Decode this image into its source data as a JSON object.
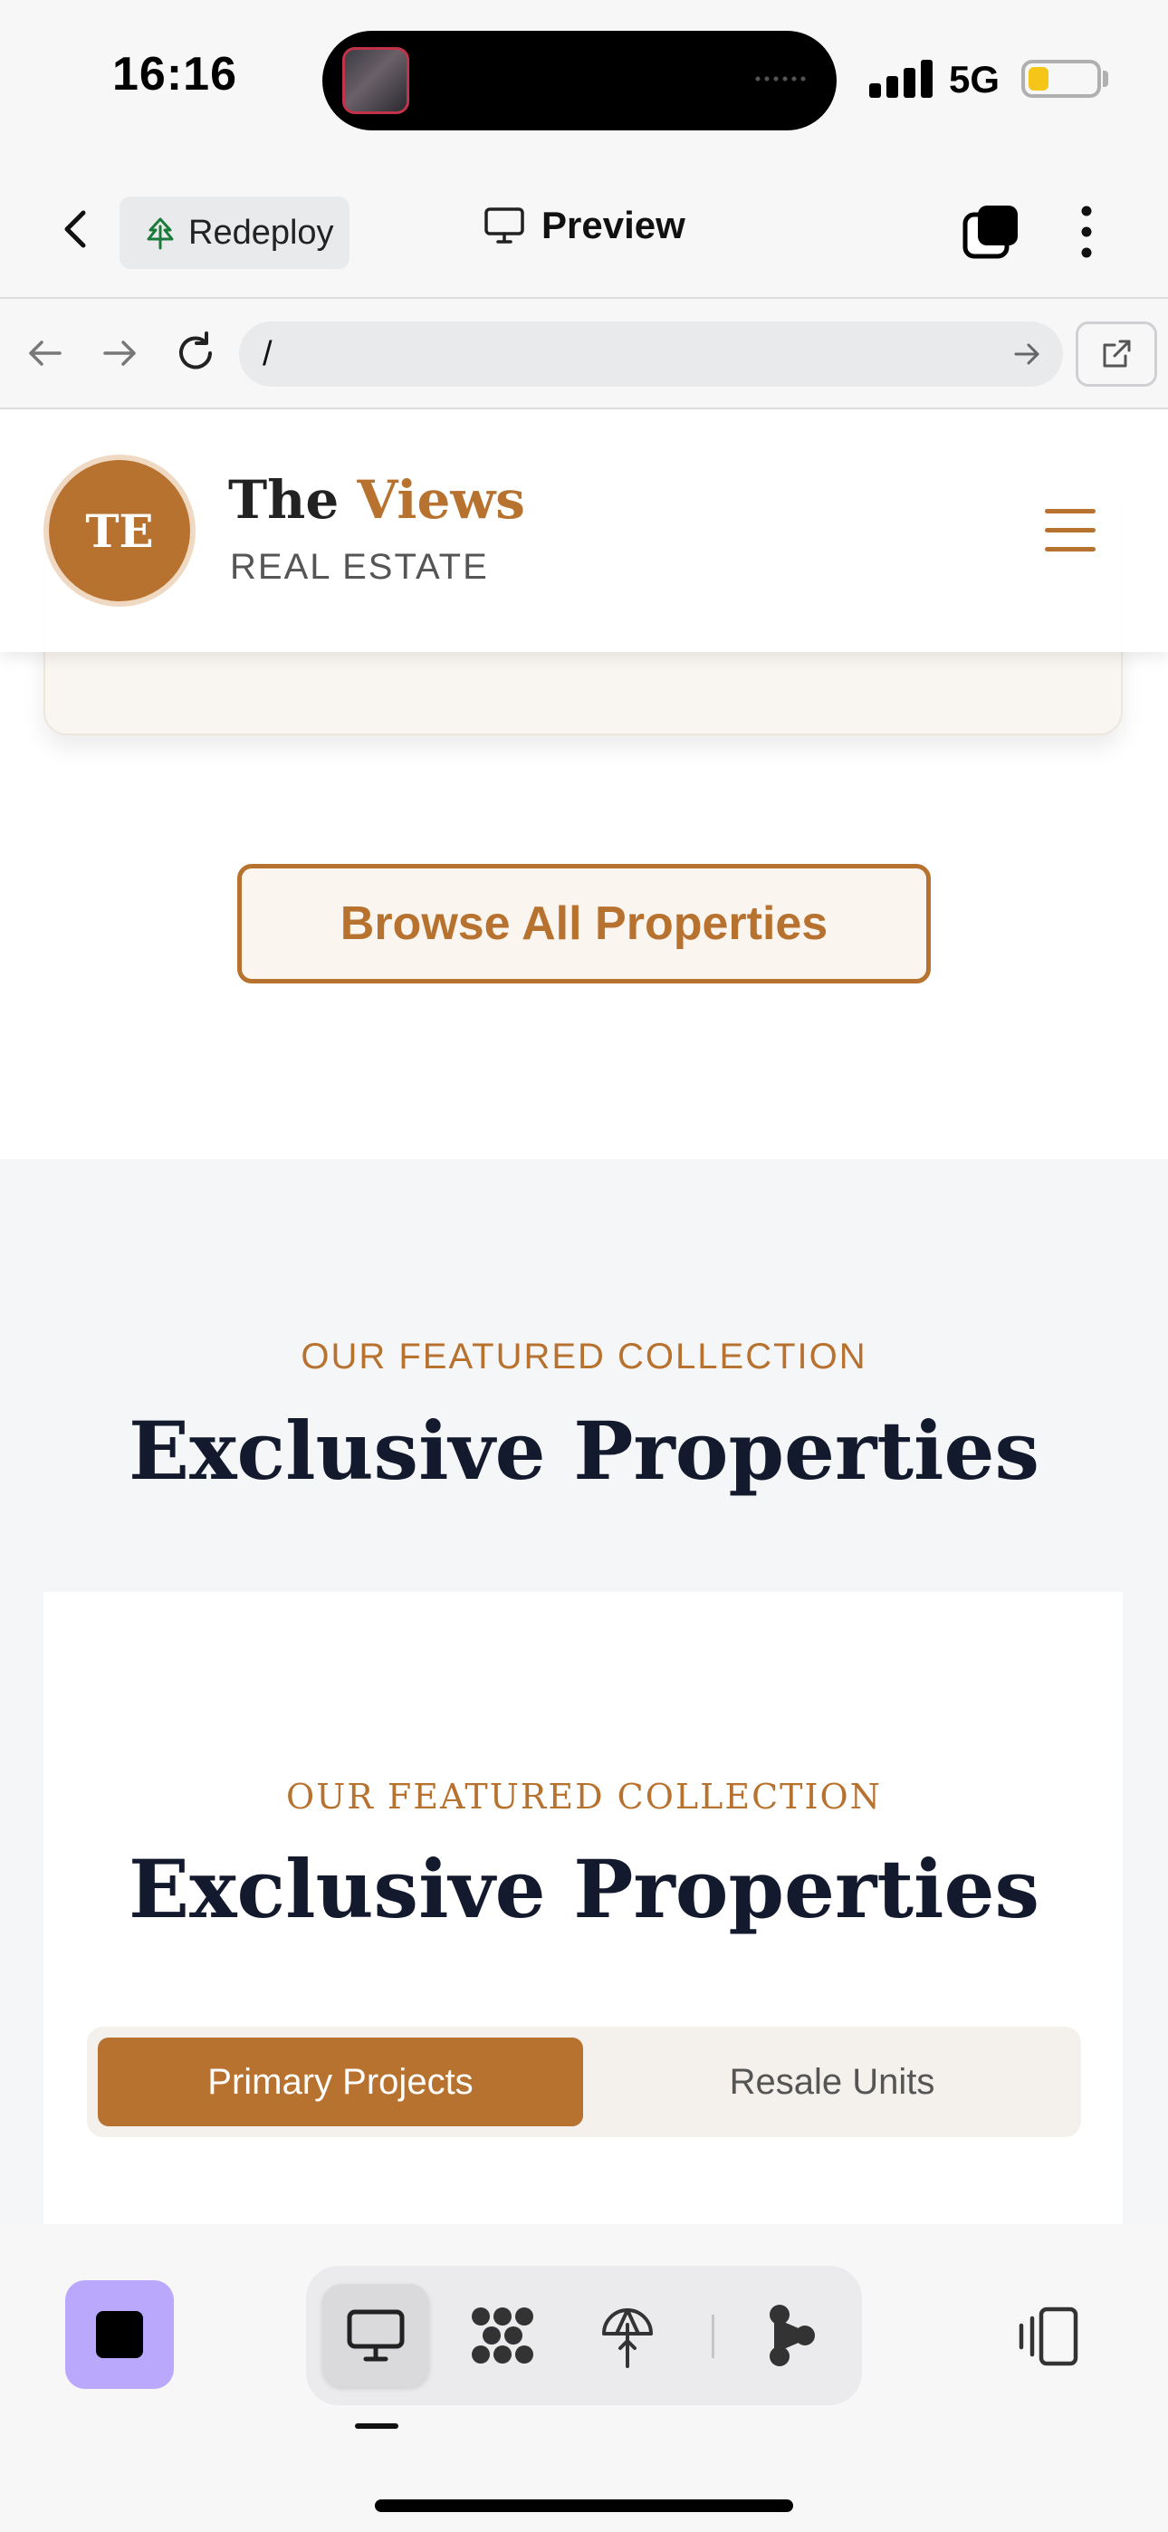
{
  "status_bar": {
    "time": "16:16",
    "network": "5G",
    "battery_level": 0.3
  },
  "toolbar": {
    "redeploy_label": "Redeploy",
    "preview_label": "Preview",
    "icons": [
      "back-icon",
      "tree-icon",
      "monitor-icon",
      "tabs-icon",
      "more-vertical-icon"
    ]
  },
  "browser": {
    "url": "/",
    "icons": [
      "arrow-left-icon",
      "arrow-right-icon",
      "reload-icon",
      "go-arrow-icon",
      "external-link-icon"
    ]
  },
  "site": {
    "logo_initials": "TE",
    "brand_prefix": "The ",
    "brand_accent": "Views",
    "brand_sub": "REAL ESTATE",
    "browse_button": "Browse All Properties",
    "featured": {
      "eyebrow": "OUR FEATURED COLLECTION",
      "heading": "Exclusive Properties"
    },
    "inner": {
      "eyebrow": "OUR FEATURED COLLECTION",
      "heading": "Exclusive Properties",
      "tabs": [
        {
          "label": "Primary Projects",
          "active": true
        },
        {
          "label": "Resale Units",
          "active": false
        }
      ]
    }
  },
  "bottom_bar": {
    "modes": [
      "monitor-icon",
      "apps-grid-icon",
      "tree-icon",
      "flow-icon"
    ],
    "active_mode": "monitor-icon"
  },
  "colors": {
    "accent": "#b8722f",
    "heading": "#141a2e",
    "stop_button": "#b9a8fb"
  }
}
